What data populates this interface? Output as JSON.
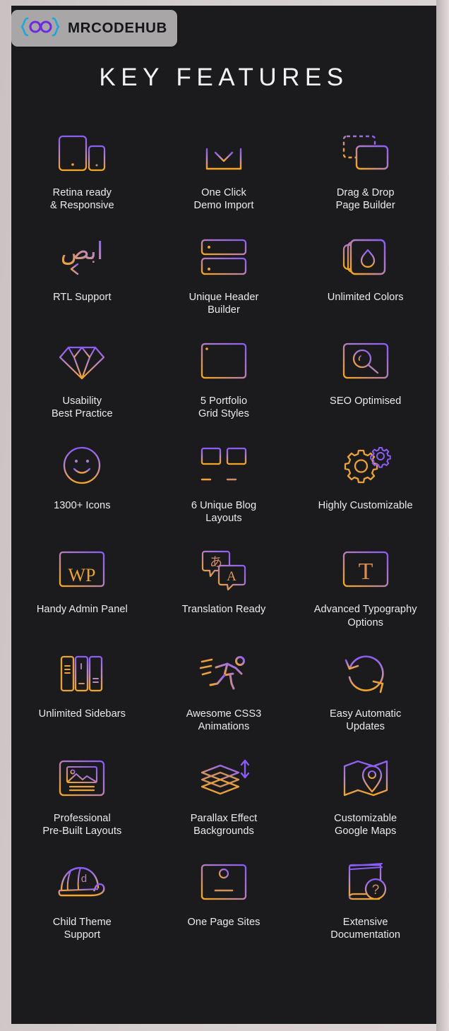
{
  "brand": {
    "wordmark": "MRCODEHUB",
    "brace_color": "#1ea7d8",
    "eye_color": "#6d2be0",
    "chip_background": "#a9a6a8",
    "wordmark_color": "#15151a"
  },
  "header": {
    "title": "KEY FEATURES"
  },
  "theme": {
    "page_background": "#d2cbcb",
    "panel_background": "#1b1b1d",
    "label_color": "#eceaea",
    "icon_gradient_top": "#8a5cf6",
    "icon_gradient_bottom": "#f5a623"
  },
  "features": [
    {
      "label": "Retina ready\n& Responsive",
      "icon": "devices-icon"
    },
    {
      "label": "One Click\nDemo Import",
      "icon": "download-tray-icon"
    },
    {
      "label": "Drag & Drop\nPage Builder",
      "icon": "drag-drop-icon"
    },
    {
      "label": "RTL Support",
      "icon": "rtl-arabic-arrow-icon"
    },
    {
      "label": "Unique Header\nBuilder",
      "icon": "header-bars-icon"
    },
    {
      "label": "Unlimited Colors",
      "icon": "color-drop-layers-icon"
    },
    {
      "label": "Usability\nBest Practice",
      "icon": "diamond-icon"
    },
    {
      "label": "5 Portfolio\nGrid Styles",
      "icon": "portfolio-grid-icon"
    },
    {
      "label": "SEO Optimised",
      "icon": "magnifier-screen-icon"
    },
    {
      "label": "1300+ Icons",
      "icon": "smiley-face-icon"
    },
    {
      "label": "6 Unique Blog\nLayouts",
      "icon": "blog-layouts-icon"
    },
    {
      "label": "Highly Customizable",
      "icon": "gears-icon"
    },
    {
      "label": "Handy Admin Panel",
      "icon": "wordpress-admin-icon"
    },
    {
      "label": "Translation Ready",
      "icon": "translation-bubbles-icon"
    },
    {
      "label": "Advanced Typography\nOptions",
      "icon": "typography-t-icon"
    },
    {
      "label": "Unlimited Sidebars",
      "icon": "sidebars-icon"
    },
    {
      "label": "Awesome CSS3\nAnimations",
      "icon": "running-man-icon"
    },
    {
      "label": "Easy Automatic\nUpdates",
      "icon": "refresh-circle-icon"
    },
    {
      "label": "Professional\nPre-Built Layouts",
      "icon": "image-layout-icon"
    },
    {
      "label": "Parallax Effect\nBackgrounds",
      "icon": "parallax-layers-icon"
    },
    {
      "label": "Customizable\nGoogle Maps",
      "icon": "map-pin-icon"
    },
    {
      "label": "Child Theme\nSupport",
      "icon": "cap-icon"
    },
    {
      "label": "One Page Sites",
      "icon": "one-page-icon"
    },
    {
      "label": "Extensive\nDocumentation",
      "icon": "book-question-icon"
    }
  ],
  "icon_glyphs": {
    "rtl_arabic": "ابص",
    "wordpress_short": "WP",
    "japanese_kana": "あ",
    "latin_letter": "A",
    "typography_letter": "T",
    "question_mark": "?",
    "cap_letter": "p"
  }
}
